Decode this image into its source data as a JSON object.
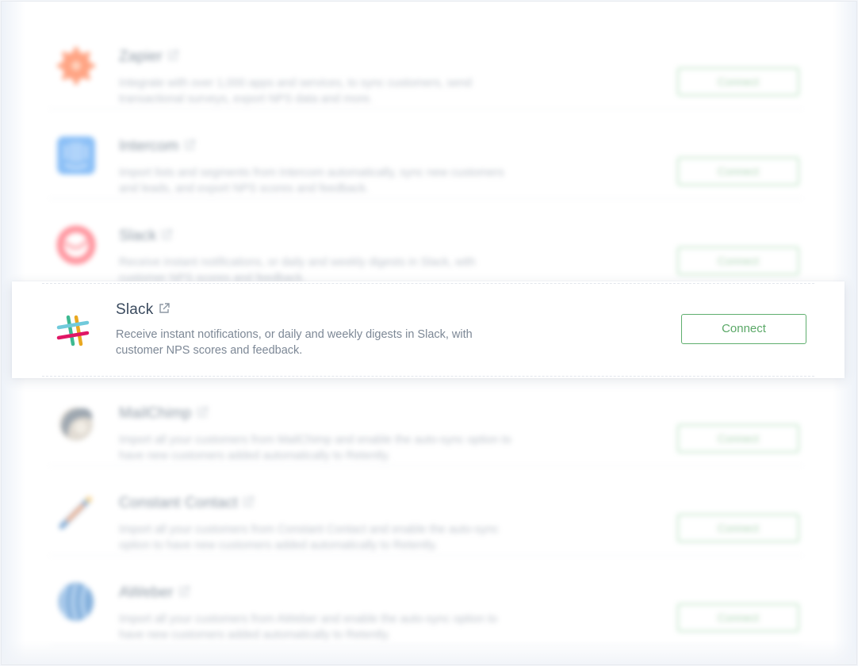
{
  "integrations": [
    {
      "name": "Zapier",
      "description": "Integrate with over 1,000 apps and services, to sync customers, send transactional surveys, export NPS data and more.",
      "button": "Connect",
      "icon": "zapier-icon",
      "color": "#ff4a00"
    },
    {
      "name": "Intercom",
      "description": "Import lists and segments from Intercom automatically, sync new customers and leads, and export NPS scores and feedback.",
      "button": "Connect",
      "icon": "intercom-icon",
      "color": "#1f8ded"
    },
    {
      "name": "Slack",
      "description": "Receive instant notifications, or daily and weekly digests in Slack, with customer NPS scores and feedback.",
      "button": "Connect",
      "icon": "slack-icon",
      "color": "#ff3b3b"
    },
    {
      "name": "Slack",
      "description": "Receive instant notifications, or daily and weekly digests in Slack, with customer NPS scores and feedback.",
      "button": "Connect",
      "icon": "slack-hash-icon",
      "color": "#5aa867"
    },
    {
      "name": "MailChimp",
      "description": "Import all your customers from MailChimp and enable the auto-sync option to have new customers added automatically to Retently.",
      "button": "Connect",
      "icon": "mailchimp-icon",
      "color": "#6b5a45"
    },
    {
      "name": "Constant Contact",
      "description": "Import all your customers from Constant Contact and enable the auto-sync option to have new customers added automatically to Retently.",
      "button": "Connect",
      "icon": "constant-contact-icon",
      "color": "#e8692c"
    },
    {
      "name": "AWeber",
      "description": "Import all your customers from AWeber and enable the auto-sync option to have new customers added automatically to Retently.",
      "button": "Connect",
      "icon": "aweber-icon",
      "color": "#1b67b3"
    }
  ]
}
